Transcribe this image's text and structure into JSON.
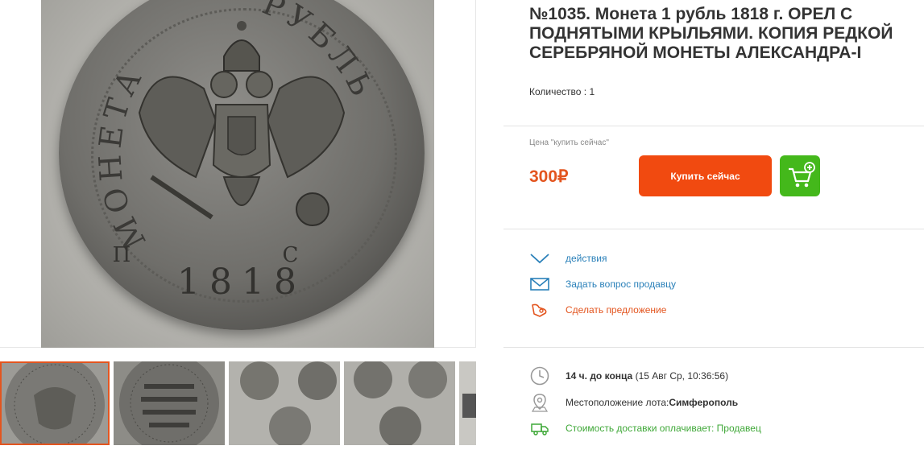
{
  "listing": {
    "title_line1": "№1035. Монета 1 рубль 1818 г. ОРЕЛ С",
    "title_line2": "ПОДНЯТЫМИ КРЫЛЬЯМИ. КОПИЯ РЕДКОЙ",
    "title_line3": "СЕРЕБРЯНОЙ МОНЕТЫ АЛЕКСАНДРА-I",
    "quantity_label": "Количество : 1"
  },
  "coin": {
    "legend_left": "МОНЕТА",
    "legend_right": "РУБЛЬ",
    "year": "1818",
    "mint_mark": "П С"
  },
  "price": {
    "caption": "Цена \"купить сейчас\"",
    "value": "300",
    "currency": "₽",
    "buy_label": "Купить сейчас",
    "color": "#e3551f"
  },
  "actions": {
    "watch": "действия",
    "ask": "Задать вопрос продавцу",
    "offer": "Сделать предложение"
  },
  "info": {
    "time_left": "14 ч. до конца",
    "end_date": "(15 Авг Ср, 10:36:56)",
    "location_label": "Местоположение лота: ",
    "location_value": "Симферополь",
    "shipping": "Стоимость доставки оплачивает: Продавец"
  },
  "colors": {
    "accent": "#f14a10",
    "cart": "#44b81b",
    "link": "#2a80b9",
    "offer": "#e3551f"
  },
  "thumbnail_count": 5
}
